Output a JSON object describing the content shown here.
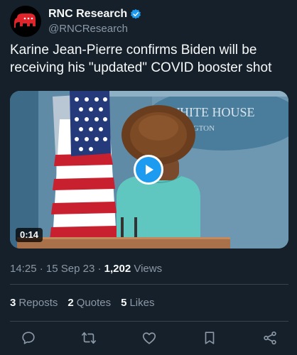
{
  "author": {
    "display_name": "RNC Research",
    "handle": "@RNCResearch",
    "verified": true,
    "avatar_icon": "republican-elephant-icon"
  },
  "tweet": {
    "text": "Karine Jean-Pierre confirms Biden will be receiving his \"updated\" COVID booster shot"
  },
  "media": {
    "type": "video",
    "duration": "0:14",
    "backdrop_text_1": "WHITE HOUSE",
    "backdrop_text_2": "SHINGTON"
  },
  "meta": {
    "time": "14:25",
    "date": "15 Sep 23",
    "views": "1,202",
    "views_label": "Views"
  },
  "stats": {
    "reposts": "3",
    "reposts_label": "Reposts",
    "quotes": "2",
    "quotes_label": "Quotes",
    "likes": "5",
    "likes_label": "Likes"
  },
  "colors": {
    "background": "#15202b",
    "accent": "#1d9bf0",
    "secondary_text": "#8b98a5",
    "divider": "#38444d"
  }
}
